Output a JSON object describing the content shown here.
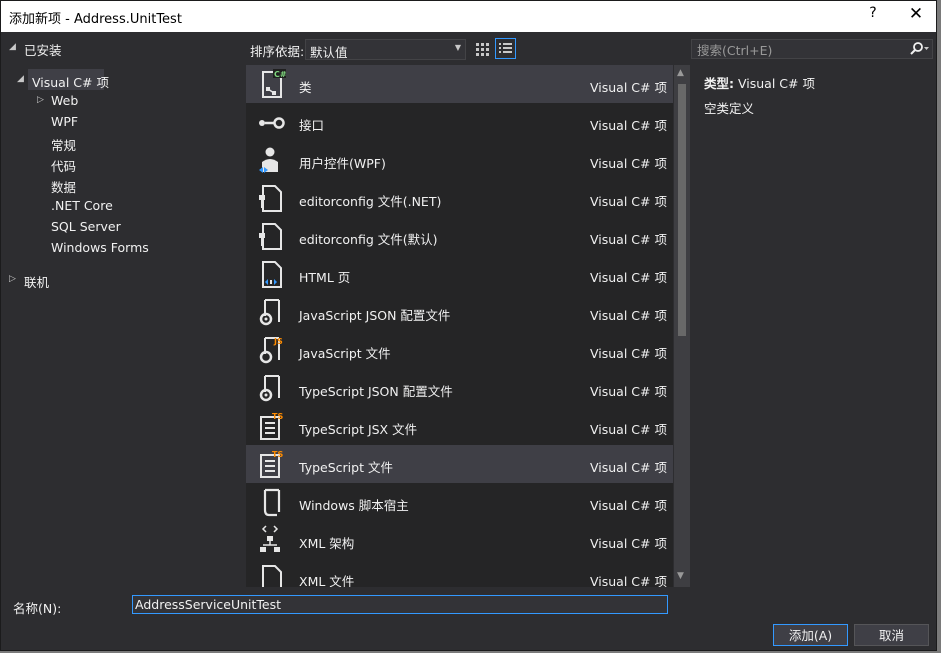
{
  "window": {
    "title": "添加新项 - Address.UnitTest",
    "help": "?",
    "close": "✕"
  },
  "tree": {
    "installed": "已安装",
    "csharp": "Visual C# 项",
    "children": [
      "Web",
      "WPF",
      "常规",
      "代码",
      "数据",
      ".NET Core",
      "SQL Server",
      "Windows Forms"
    ],
    "online": "联机"
  },
  "toolbar": {
    "sort_label": "排序依据:",
    "sort_value": "默认值"
  },
  "search": {
    "placeholder": "搜索(Ctrl+E)"
  },
  "items": [
    {
      "name": "类",
      "type": "Visual C# 项",
      "icon": "class-icon"
    },
    {
      "name": "接口",
      "type": "Visual C# 项",
      "icon": "interface-icon"
    },
    {
      "name": "用户控件(WPF)",
      "type": "Visual C# 项",
      "icon": "user-control-icon"
    },
    {
      "name": "editorconfig 文件(.NET)",
      "type": "Visual C# 项",
      "icon": "editorconfig-icon"
    },
    {
      "name": "editorconfig 文件(默认)",
      "type": "Visual C# 项",
      "icon": "editorconfig-icon"
    },
    {
      "name": "HTML 页",
      "type": "Visual C# 项",
      "icon": "html-page-icon"
    },
    {
      "name": "JavaScript JSON 配置文件",
      "type": "Visual C# 项",
      "icon": "json-config-icon"
    },
    {
      "name": "JavaScript 文件",
      "type": "Visual C# 项",
      "icon": "javascript-file-icon"
    },
    {
      "name": "TypeScript JSON 配置文件",
      "type": "Visual C# 项",
      "icon": "json-config-icon"
    },
    {
      "name": "TypeScript JSX 文件",
      "type": "Visual C# 项",
      "icon": "typescript-file-icon"
    },
    {
      "name": "TypeScript 文件",
      "type": "Visual C# 项",
      "icon": "typescript-file-icon"
    },
    {
      "name": "Windows 脚本宿主",
      "type": "Visual C# 项",
      "icon": "script-host-icon"
    },
    {
      "name": "XML 架构",
      "type": "Visual C# 项",
      "icon": "xml-schema-icon"
    },
    {
      "name": "XML 文件",
      "type": "Visual C# 项",
      "icon": "xml-file-icon"
    }
  ],
  "description": {
    "type_label": "类型:",
    "type_value": "Visual C# 项",
    "text": "空类定义"
  },
  "bottom": {
    "name_label": "名称(N):",
    "name_value": "AddressServiceUnitTest",
    "add": "添加(A)",
    "cancel": "取消"
  }
}
